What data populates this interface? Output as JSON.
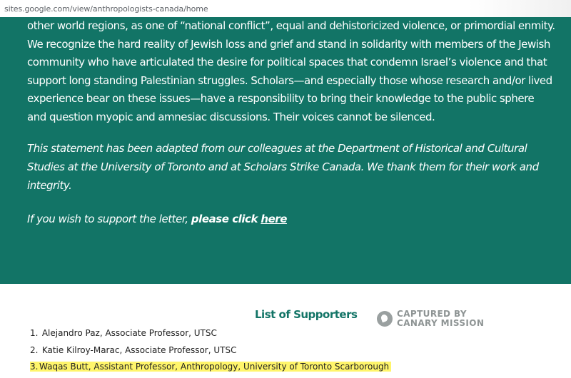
{
  "browser": {
    "url": "sites.google.com/view/anthropologists-canada/home"
  },
  "statement": {
    "body": "other world regions, as one of “national conflict”, equal and dehistoricized violence, or primordial enmity. We recognize the hard reality of Jewish loss and grief and stand in solidarity with members of the Jewish community who have articulated the desire for political spaces that condemn Israel’s violence and that support long standing Palestinian struggles. Scholars—and especially those whose research and/or lived experience bear on these issues—have a responsibility to bring their knowledge to the public sphere and question myopic and amnesiac discussions. Their voices cannot be silenced.",
    "adaptation_note": "This statement has been adapted from our colleagues at the Department of Historical and Cultural Studies at the University of Toronto and at Scholars Strike Canada. We thank them for their work and integrity.",
    "support_prefix": "If you wish to support the letter, ",
    "support_bold": "please click",
    "support_link": "here"
  },
  "supporters": {
    "title": "List of Supporters",
    "items": [
      {
        "number": "1.",
        "text": "Alejandro Paz, Associate Professor, UTSC",
        "highlighted": false
      },
      {
        "number": "2.",
        "text": "Katie Kilroy-Marac, Associate Professor, UTSC",
        "highlighted": false
      },
      {
        "number": "3.",
        "text": "Waqas Butt, Assistant Professor, Anthropology, University of Toronto Scarborough",
        "highlighted": true
      }
    ]
  },
  "watermark": {
    "line1": "CAPTURED BY",
    "line2": "CANARY MISSION",
    "icon": "canary-bird-icon"
  },
  "colors": {
    "panel_bg": "#127466",
    "title_color": "#127466",
    "highlight": "#fff56b",
    "watermark": "#8e9494"
  }
}
